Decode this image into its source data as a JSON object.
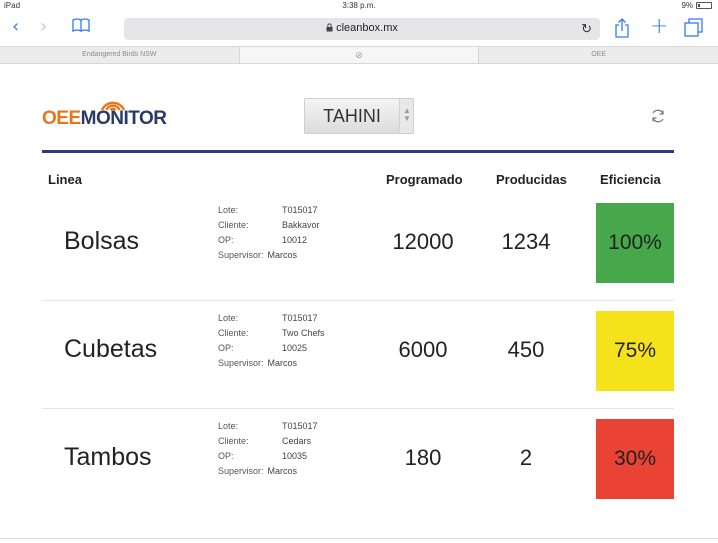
{
  "status_bar": {
    "device": "iPad",
    "time": "3:38 p.m.",
    "battery": "9%"
  },
  "browser": {
    "url": "cleanbox.mx",
    "lock_icon": "lock-icon",
    "tabs": [
      {
        "label": "Endangered Birds NSW",
        "active": false
      },
      {
        "label": "",
        "active": true,
        "close_icon": "close-icon"
      },
      {
        "label": "OEE",
        "active": false
      }
    ]
  },
  "app": {
    "logo": {
      "part1": "OEE",
      "part2": "M",
      "part3": "NITOR",
      "colors": {
        "oee": "#e8751a",
        "monitor": "#2a3a66"
      }
    },
    "selector": {
      "value": "TAHINI"
    },
    "divider_color": "#2a3a7a",
    "table": {
      "headers": {
        "line": "Linea",
        "scheduled": "Programado",
        "produced": "Producidas",
        "efficiency": "Eficiencia"
      },
      "detail_labels": {
        "lot": "Lote:",
        "client": "Cliente:",
        "op": "OP:",
        "supervisor": "Supervisor:"
      },
      "rows": [
        {
          "line": "Bolsas",
          "lot": "T015017",
          "client": "Bakkavor",
          "op": "10012",
          "supervisor": "Marcos",
          "scheduled": "12000",
          "produced": "1234",
          "efficiency": "100%",
          "color": "#46a84a"
        },
        {
          "line": "Cubetas",
          "lot": "T015017",
          "client": "Two Chefs",
          "op": "10025",
          "supervisor": "Marcos",
          "scheduled": "6000",
          "produced": "450",
          "efficiency": "75%",
          "color": "#f4e31a"
        },
        {
          "line": "Tambos",
          "lot": "T015017",
          "client": "Cedars",
          "op": "10035",
          "supervisor": "Marcos",
          "scheduled": "180",
          "produced": "2",
          "efficiency": "30%",
          "color": "#ea4335"
        }
      ]
    }
  }
}
